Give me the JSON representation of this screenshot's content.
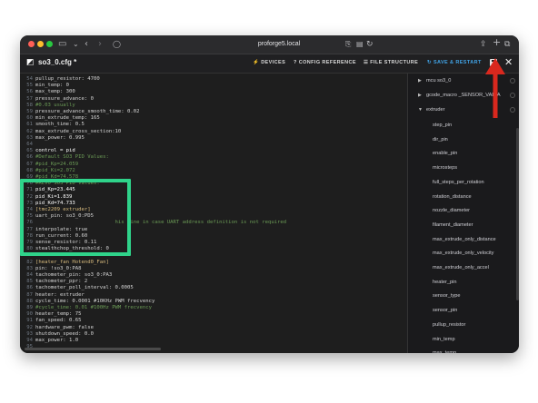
{
  "browser": {
    "url": "proforge5.local"
  },
  "app": {
    "file_title": "so3_0.cfg *",
    "buttons": {
      "devices": "DEVICES",
      "config_reference": "CONFIG REFERENCE",
      "file_structure": "FILE STRUCTURE",
      "save_restart": "SAVE & RESTART"
    },
    "accent_color": "#41a3e6",
    "highlight_color": "#2fd38a",
    "annotation_arrow_color": "#d9281e"
  },
  "editor": {
    "lines": [
      {
        "n": "54",
        "text": "pullup_resistor: 4700",
        "style": "key"
      },
      {
        "n": "55",
        "text": "min_temp: 0",
        "style": "key"
      },
      {
        "n": "56",
        "text": "max_temp: 300",
        "style": "key"
      },
      {
        "n": "57",
        "text": "pressure_advance: 0",
        "style": "key"
      },
      {
        "n": "58",
        "text": "#0.03 usually",
        "style": "cmt"
      },
      {
        "n": "59",
        "text": "pressure_advance_smooth_time: 0.02",
        "style": "key"
      },
      {
        "n": "60",
        "text": "min_extrude_temp: 165",
        "style": "key"
      },
      {
        "n": "61",
        "text": "smooth_time: 0.5",
        "style": "key"
      },
      {
        "n": "62",
        "text": "max_extrude_cross_section:10",
        "style": "key"
      },
      {
        "n": "63",
        "text": "max_power: 0.995",
        "style": "key"
      },
      {
        "n": "64",
        "text": "",
        "style": "key"
      },
      {
        "n": "65",
        "text": "control = pid",
        "style": "hl"
      },
      {
        "n": "66",
        "text": "#Default SO3 PID Values:",
        "style": "cmt"
      },
      {
        "n": "67",
        "text": "#pid_Kp=24.059",
        "style": "cmt"
      },
      {
        "n": "68",
        "text": "#pid_Ki=2.072",
        "style": "cmt"
      },
      {
        "n": "69",
        "text": "#pid_Kd=74.578",
        "style": "cmt"
      },
      {
        "n": "70",
        "text": "#REV0 SO3 PID Values:",
        "style": "cmt"
      },
      {
        "n": "71",
        "text": "pid_Kp=23.445",
        "style": "hl"
      },
      {
        "n": "72",
        "text": "pid_Ki=1.839",
        "style": "hl"
      },
      {
        "n": "73",
        "text": "pid_Kd=74.733",
        "style": "hl"
      },
      {
        "n": "74",
        "text": "[tmc2209 extruder]",
        "style": "sec"
      },
      {
        "n": "75",
        "text": "uart_pin: so3_0:PD5",
        "style": "key"
      },
      {
        "n": "76",
        "text": "                          his line in case UART address definition is not required",
        "style": "cmt"
      },
      {
        "n": "77",
        "text": "interpolate: true",
        "style": "key"
      },
      {
        "n": "78",
        "text": "run_current: 0.60",
        "style": "key"
      },
      {
        "n": "79",
        "text": "sense_resistor: 0.11",
        "style": "key"
      },
      {
        "n": "80",
        "text": "stealthchop_threshold: 0",
        "style": "key"
      },
      {
        "n": "81",
        "text": "",
        "style": "key"
      },
      {
        "n": "82",
        "text": "[heater_fan Hotend0_Fan]",
        "style": "sec"
      },
      {
        "n": "83",
        "text": "pin: !so3_0:PA8",
        "style": "key"
      },
      {
        "n": "84",
        "text": "tachometer_pin: so3_0:PA3",
        "style": "key"
      },
      {
        "n": "85",
        "text": "tachometer_ppr: 2",
        "style": "key"
      },
      {
        "n": "86",
        "text": "tachometer_poll_interval: 0.0005",
        "style": "key"
      },
      {
        "n": "87",
        "text": "heater: extruder",
        "style": "key"
      },
      {
        "n": "88",
        "text": "cycle_time: 0.0001 #10KHz PWM frecvency",
        "style": "key"
      },
      {
        "n": "89",
        "text": "#cycle_time: 0.01 #100Hz PWM frecvency",
        "style": "cmt"
      },
      {
        "n": "90",
        "text": "heater_temp: 75",
        "style": "key"
      },
      {
        "n": "91",
        "text": "fan_speed: 0.65",
        "style": "key"
      },
      {
        "n": "92",
        "text": "hardware_pwm: false",
        "style": "key"
      },
      {
        "n": "93",
        "text": "shutdown_speed: 0.0",
        "style": "key"
      },
      {
        "n": "94",
        "text": "max_power: 1.0",
        "style": "key"
      },
      {
        "n": "95",
        "text": "",
        "style": "key"
      }
    ]
  },
  "tree": {
    "items": [
      {
        "label": "mcu so3_0",
        "level": "root",
        "arrow": "▶"
      },
      {
        "label": "gcode_macro _SENSOR_VARIA",
        "level": "root",
        "arrow": "▶"
      },
      {
        "label": "extruder",
        "level": "root",
        "arrow": "▼"
      },
      {
        "label": "step_pin",
        "level": "child"
      },
      {
        "label": "dir_pin",
        "level": "child"
      },
      {
        "label": "enable_pin",
        "level": "child"
      },
      {
        "label": "microsteps",
        "level": "child"
      },
      {
        "label": "full_steps_per_rotation",
        "level": "child"
      },
      {
        "label": "rotation_distance",
        "level": "child"
      },
      {
        "label": "nozzle_diameter",
        "level": "child"
      },
      {
        "label": "filament_diameter",
        "level": "child"
      },
      {
        "label": "max_extrude_only_distance",
        "level": "child"
      },
      {
        "label": "max_extrude_only_velocity",
        "level": "child"
      },
      {
        "label": "max_extrude_only_accel",
        "level": "child"
      },
      {
        "label": "heater_pin",
        "level": "child"
      },
      {
        "label": "sensor_type",
        "level": "child"
      },
      {
        "label": "sensor_pin",
        "level": "child"
      },
      {
        "label": "pullup_resistor",
        "level": "child"
      },
      {
        "label": "min_temp",
        "level": "child"
      },
      {
        "label": "max_temp",
        "level": "child"
      }
    ]
  }
}
